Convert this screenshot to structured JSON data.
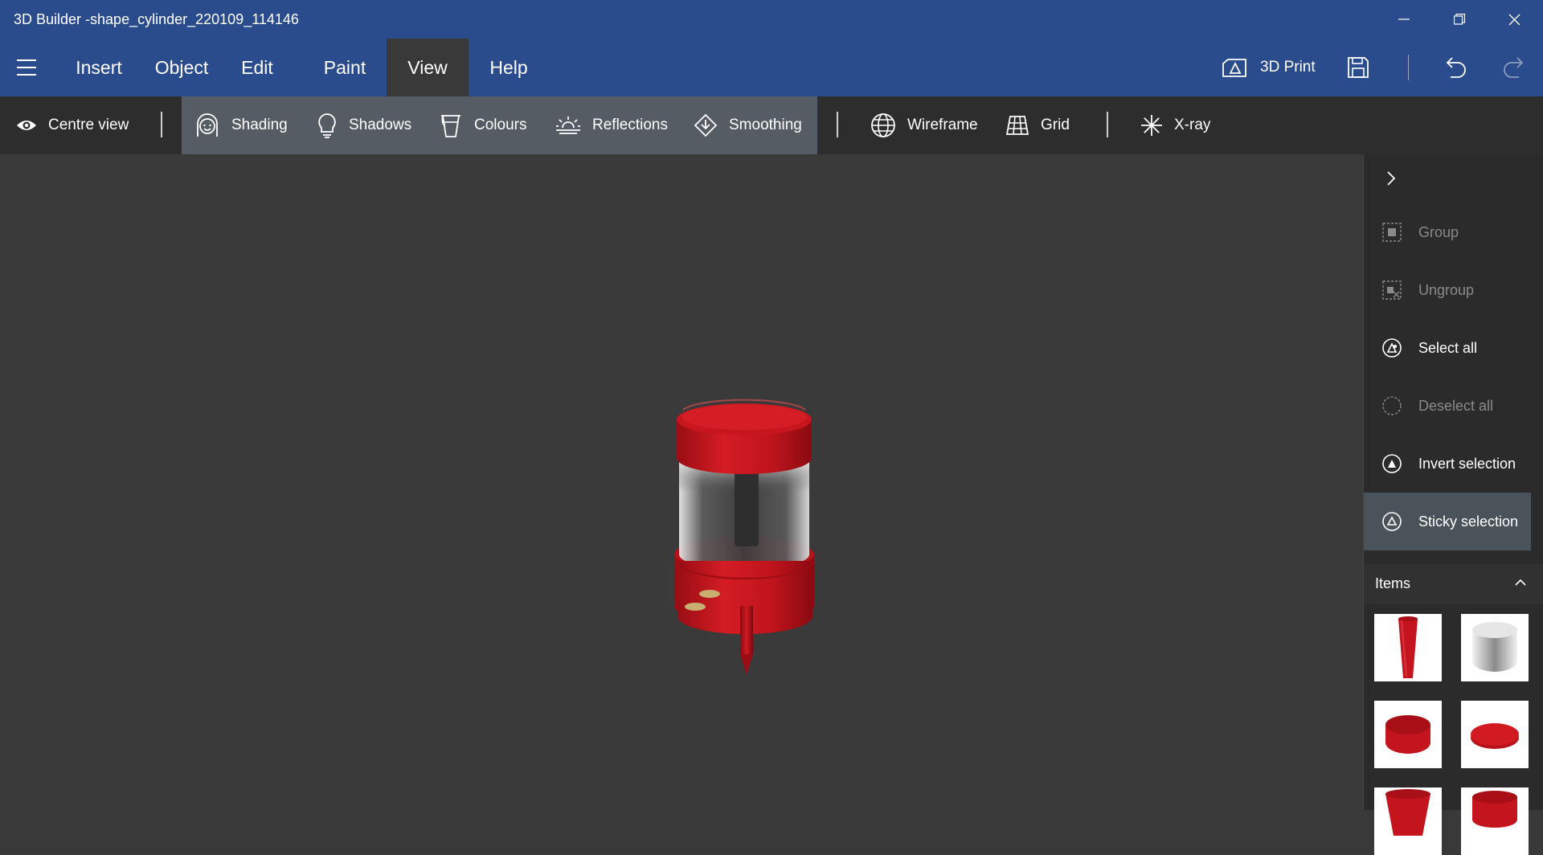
{
  "window": {
    "title": "3D Builder -shape_cylinder_220109_114146"
  },
  "menu": {
    "items": [
      {
        "label": "Insert"
      },
      {
        "label": "Object"
      },
      {
        "label": "Edit"
      },
      {
        "label": "Paint"
      },
      {
        "label": "View",
        "active": true
      },
      {
        "label": "Help"
      }
    ],
    "print_label": "3D Print"
  },
  "toolbar": {
    "centre_view": "Centre view",
    "shading": "Shading",
    "shadows": "Shadows",
    "colours": "Colours",
    "reflections": "Reflections",
    "smoothing": "Smoothing",
    "wireframe": "Wireframe",
    "grid": "Grid",
    "xray": "X-ray"
  },
  "side_panel": {
    "actions": [
      {
        "label": "Group",
        "enabled": false
      },
      {
        "label": "Ungroup",
        "enabled": false
      },
      {
        "label": "Select all",
        "enabled": true
      },
      {
        "label": "Deselect all",
        "enabled": false
      },
      {
        "label": "Invert selection",
        "enabled": true
      },
      {
        "label": "Sticky selection",
        "enabled": true,
        "active": true
      }
    ],
    "items_header": "Items"
  },
  "colors": {
    "titlebar": "#2b4c8c",
    "model_red": "#c4141d",
    "viewport": "#3a3a3a"
  }
}
